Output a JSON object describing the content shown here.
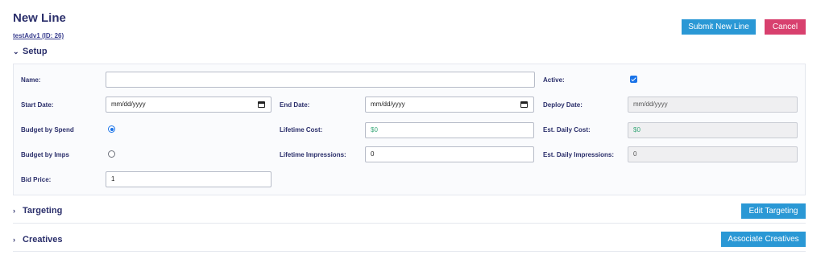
{
  "page": {
    "title": "New Line",
    "advertiser_link": "testAdv1 (ID: 26)"
  },
  "actions": {
    "submit_label": "Submit New Line",
    "cancel_label": "Cancel"
  },
  "sections": {
    "setup": {
      "label": "Setup",
      "expanded": true
    },
    "targeting": {
      "label": "Targeting",
      "expanded": false,
      "button_label": "Edit Targeting"
    },
    "creatives": {
      "label": "Creatives",
      "expanded": false,
      "button_label": "Associate Creatives"
    }
  },
  "form": {
    "name": {
      "label": "Name:",
      "value": ""
    },
    "active": {
      "label": "Active:",
      "checked": true
    },
    "start_date": {
      "label": "Start Date:",
      "placeholder": "mm/dd/yyyy"
    },
    "end_date": {
      "label": "End Date:",
      "placeholder": "mm/dd/yyyy"
    },
    "deploy_date": {
      "label": "Deploy Date:",
      "value": "mm/dd/yyyy"
    },
    "budget_by_spend": {
      "label": "Budget by Spend",
      "selected": true
    },
    "budget_by_imps": {
      "label": "Budget by Imps",
      "selected": false
    },
    "lifetime_cost": {
      "label": "Lifetime Cost:",
      "value": "$0"
    },
    "est_daily_cost": {
      "label": "Est. Daily Cost:",
      "value": "$0"
    },
    "lifetime_impressions": {
      "label": "Lifetime Impressions:",
      "value": "0"
    },
    "est_daily_impressions": {
      "label": "Est. Daily Impressions:",
      "value": "0"
    },
    "bid_price": {
      "label": "Bid Price:",
      "value": "1"
    }
  },
  "colors": {
    "primary": "#2a98d5",
    "danger": "#d8406e",
    "heading": "#2b2f6b",
    "money": "#3aa87a"
  }
}
